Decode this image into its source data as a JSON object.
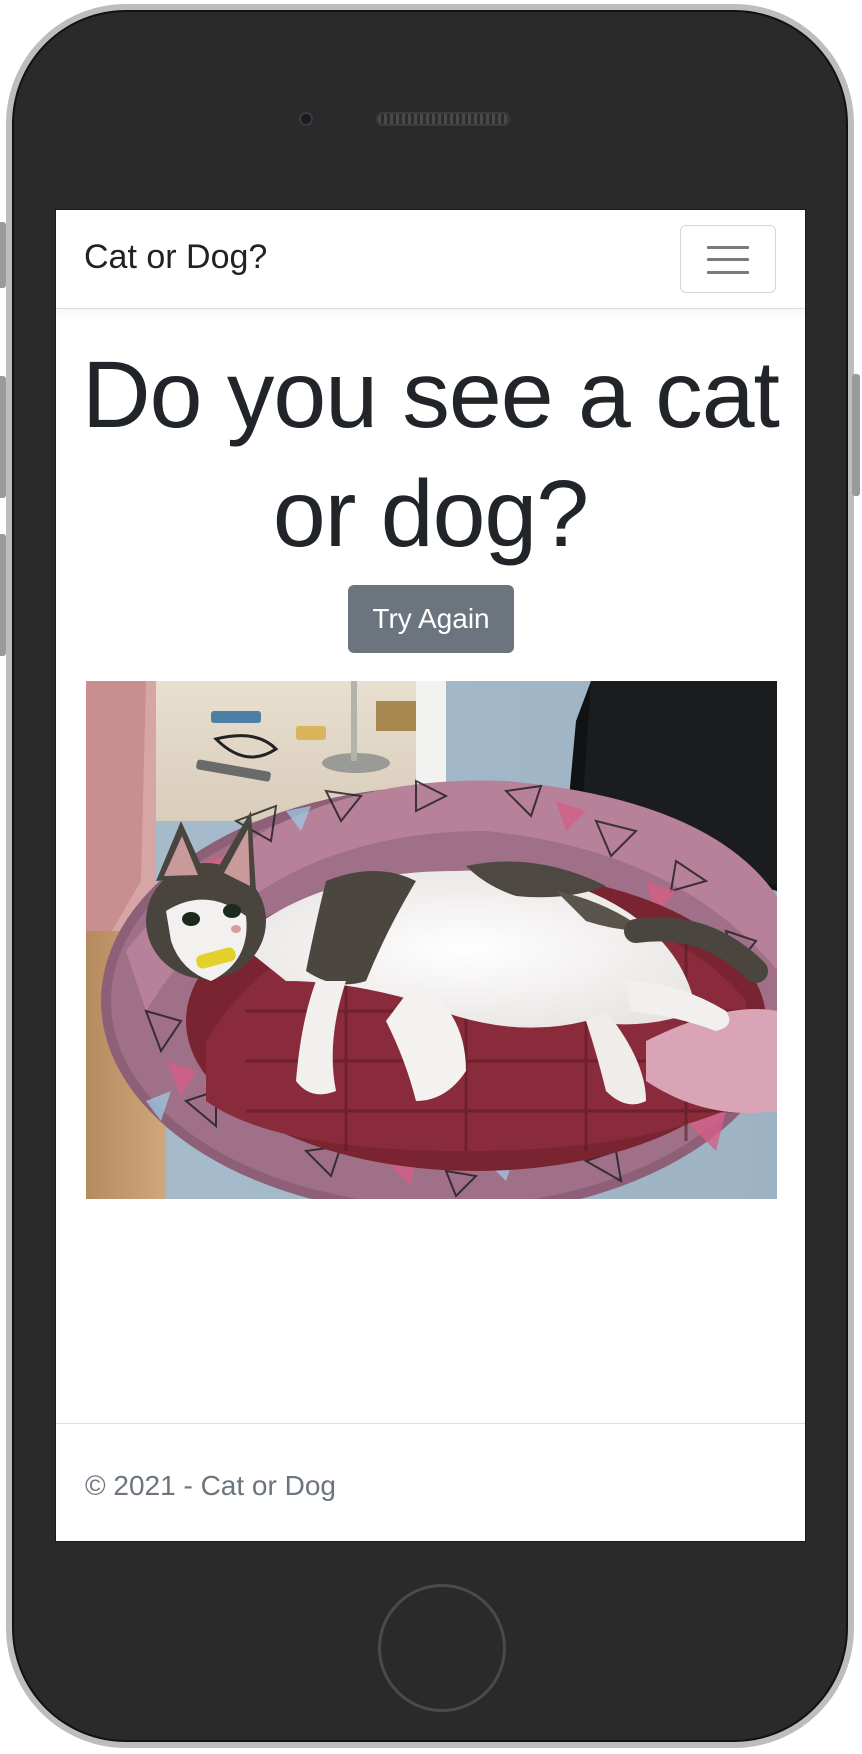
{
  "navbar": {
    "brand": "Cat or Dog?",
    "toggler_icon": "hamburger-menu-icon"
  },
  "main": {
    "heading": "Do you see a cat or dog?",
    "try_again_label": "Try Again",
    "image_description_icon": "cat-photo"
  },
  "footer": {
    "text": "© 2021 - Cat or Dog"
  },
  "colors": {
    "button_bg": "#6c757d",
    "heading": "#212529",
    "footer_text": "#6c757d",
    "device_body": "#2a2a2a"
  }
}
